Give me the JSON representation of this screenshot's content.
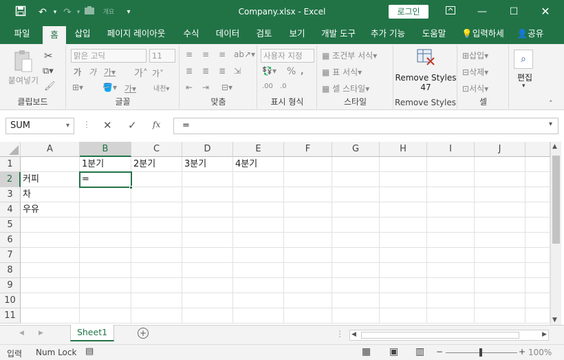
{
  "title": {
    "filename_app": "Company.xlsx  -  Excel",
    "login": "로그인"
  },
  "tabs": [
    "파일",
    "홈",
    "삽입",
    "페이지 레이아웃",
    "수식",
    "데이터",
    "검토",
    "보기",
    "개발 도구",
    "추가 기능",
    "도움말"
  ],
  "tell_me": "입력하세",
  "share": "공유",
  "ribbon": {
    "clipboard": {
      "paste": "붙여넣기",
      "label": "클립보드"
    },
    "font": {
      "name": "맑은 고딕",
      "size": "11",
      "label": "글꼴"
    },
    "align": {
      "label": "맞춤"
    },
    "number": {
      "format": "사용자 지정",
      "label": "표시 형식"
    },
    "styles": {
      "cond": "조건부 서식",
      "table": "표 서식",
      "cell": "셀 스타일",
      "label": "스타일"
    },
    "remove": {
      "line1": "Remove Styles",
      "line2": "47",
      "label": "Remove Styles"
    },
    "cells": {
      "insert": "삽입",
      "delete": "삭제",
      "format": "서식",
      "label": "셀"
    },
    "edit": {
      "label": "편집"
    }
  },
  "formula": {
    "namebox": "SUM",
    "content": "=",
    "fx": "fx"
  },
  "columns": [
    "A",
    "B",
    "C",
    "D",
    "E",
    "F",
    "G",
    "H",
    "I",
    "J"
  ],
  "rows": [
    "1",
    "2",
    "3",
    "4",
    "5",
    "6",
    "7",
    "8",
    "9",
    "10",
    "11"
  ],
  "cells": {
    "B1": "1분기",
    "C1": "2분기",
    "D1": "3분기",
    "E1": "4분기",
    "A2": "커피",
    "A3": "차",
    "A4": "우유",
    "B2": "="
  },
  "sheet": {
    "name": "Sheet1"
  },
  "status": {
    "mode": "입력",
    "numlock": "Num Lock",
    "zoom": "100%"
  }
}
